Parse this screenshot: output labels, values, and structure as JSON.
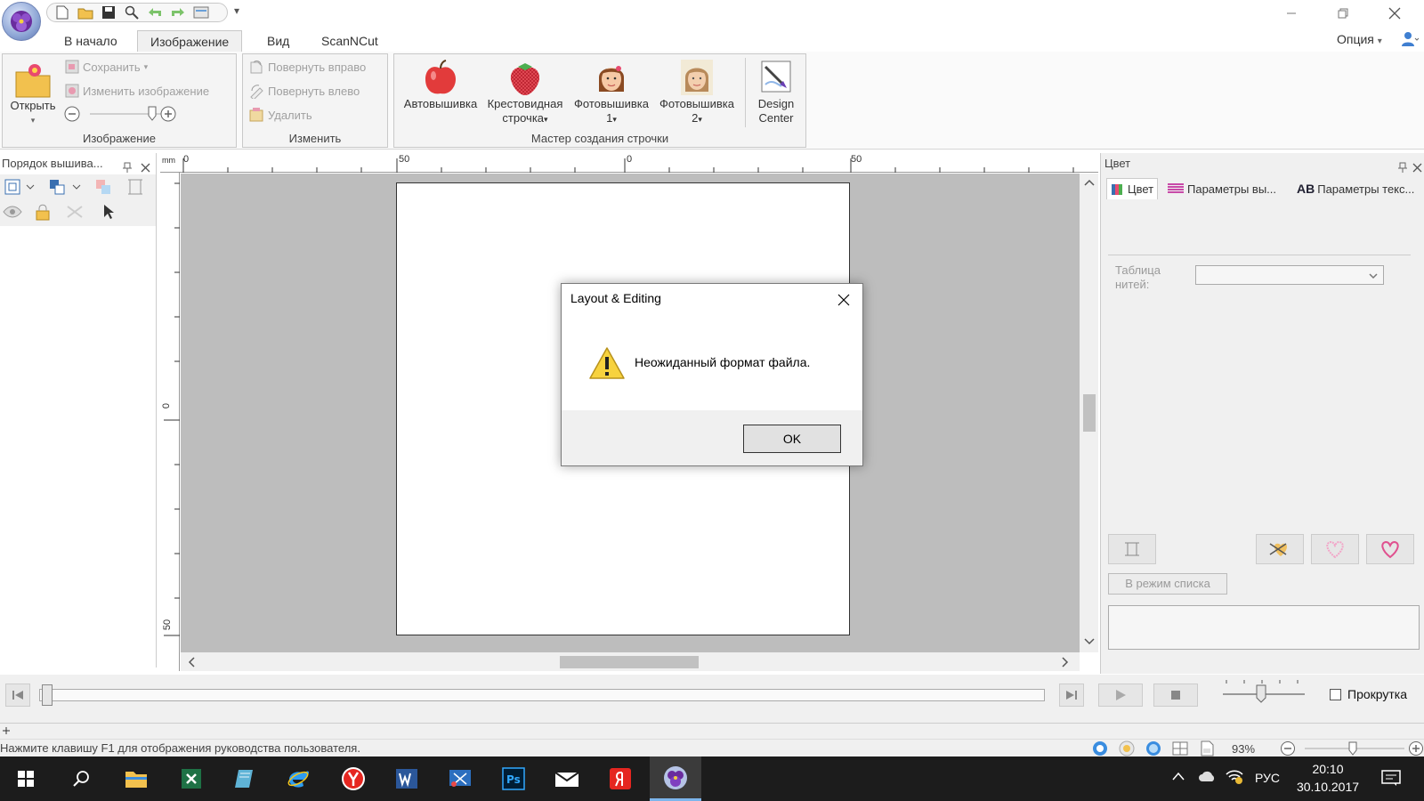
{
  "window": {
    "title_qat_dropdown": "▾"
  },
  "tabs": [
    {
      "label": "В начало"
    },
    {
      "label": "Изображение"
    },
    {
      "label": "Вид"
    },
    {
      "label": "ScanNCut"
    }
  ],
  "option_label": "Опция",
  "ribbon": {
    "image_group": {
      "label": "Изображение",
      "open": "Открыть",
      "save": "Сохранить",
      "edit_image": "Изменить изображение"
    },
    "edit_group": {
      "label": "Изменить",
      "rotate_right": "Повернуть вправо",
      "rotate_left": "Повернуть влево",
      "delete": "Удалить"
    },
    "wizard_group": {
      "label": "Мастер создания строчки",
      "auto": "Автовышивка",
      "cross1": "Крестовидная",
      "cross2": "строчка",
      "photo1a": "Фотовышивка",
      "photo1b": "1",
      "photo2a": "Фотовышивка",
      "photo2b": "2"
    },
    "design_center": {
      "line1": "Design",
      "line2": "Center"
    }
  },
  "left_panel": {
    "title": "Порядок вышива..."
  },
  "ruler": {
    "unit": "mm",
    "h_ticks": [
      "50",
      "0",
      "50"
    ],
    "v_ticks": [
      "0",
      "50"
    ],
    "h_start": "0"
  },
  "right_panel": {
    "title": "Цвет",
    "tabs": [
      {
        "label": "Цвет"
      },
      {
        "label": "Параметры вы..."
      },
      {
        "label": "Параметры текс..."
      }
    ],
    "thread_table_label1": "Таблица",
    "thread_table_label2": "нитей:",
    "list_mode_button": "В режим списка"
  },
  "player": {
    "scroll_label": "Прокрутка"
  },
  "status": {
    "hint": "Нажмите клавишу F1 для отображения руководства пользователя.",
    "zoom": "93%"
  },
  "dialog": {
    "title": "Layout & Editing",
    "message": "Неожиданный формат файла.",
    "ok": "OK"
  },
  "taskbar": {
    "lang": "РУС",
    "time": "20:10",
    "date": "30.10.2017"
  },
  "colors": {
    "accent": "#1c1c1c",
    "dialog_footer": "#f0f0f0",
    "canvas_bg": "#bdbdbd"
  }
}
